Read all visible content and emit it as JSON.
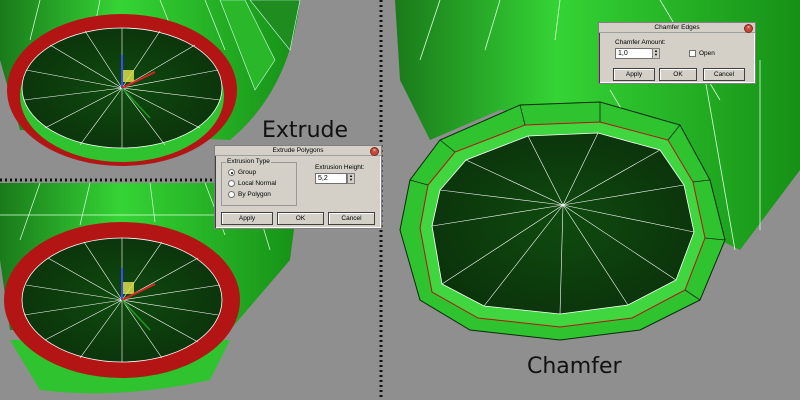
{
  "captions": {
    "extrude": "Extrude",
    "chamfer": "Chamfer"
  },
  "extrude_dialog": {
    "title": "Extrude Polygons",
    "group_label": "Extrusion Type",
    "options": [
      "Group",
      "Local Normal",
      "By Polygon"
    ],
    "selected_option": "Group",
    "height_label": "Extrusion Height:",
    "height_value": "5,2",
    "apply": "Apply",
    "ok": "OK",
    "cancel": "Cancel"
  },
  "chamfer_dialog": {
    "title": "Chamfer Edges",
    "amount_label": "Chamfer Amount:",
    "amount_value": "1,0",
    "open_label": "Open",
    "open_checked": false,
    "apply": "Apply",
    "ok": "OK",
    "cancel": "Cancel"
  },
  "colors": {
    "background": "#8f8f8f",
    "mesh_green": "#2fc42f",
    "mesh_dark": "#0d3a0d",
    "selection_red": "#b31515",
    "edge_white": "#ffffff",
    "divider": "#111111"
  },
  "gizmo_axes": [
    "x",
    "y",
    "z"
  ]
}
